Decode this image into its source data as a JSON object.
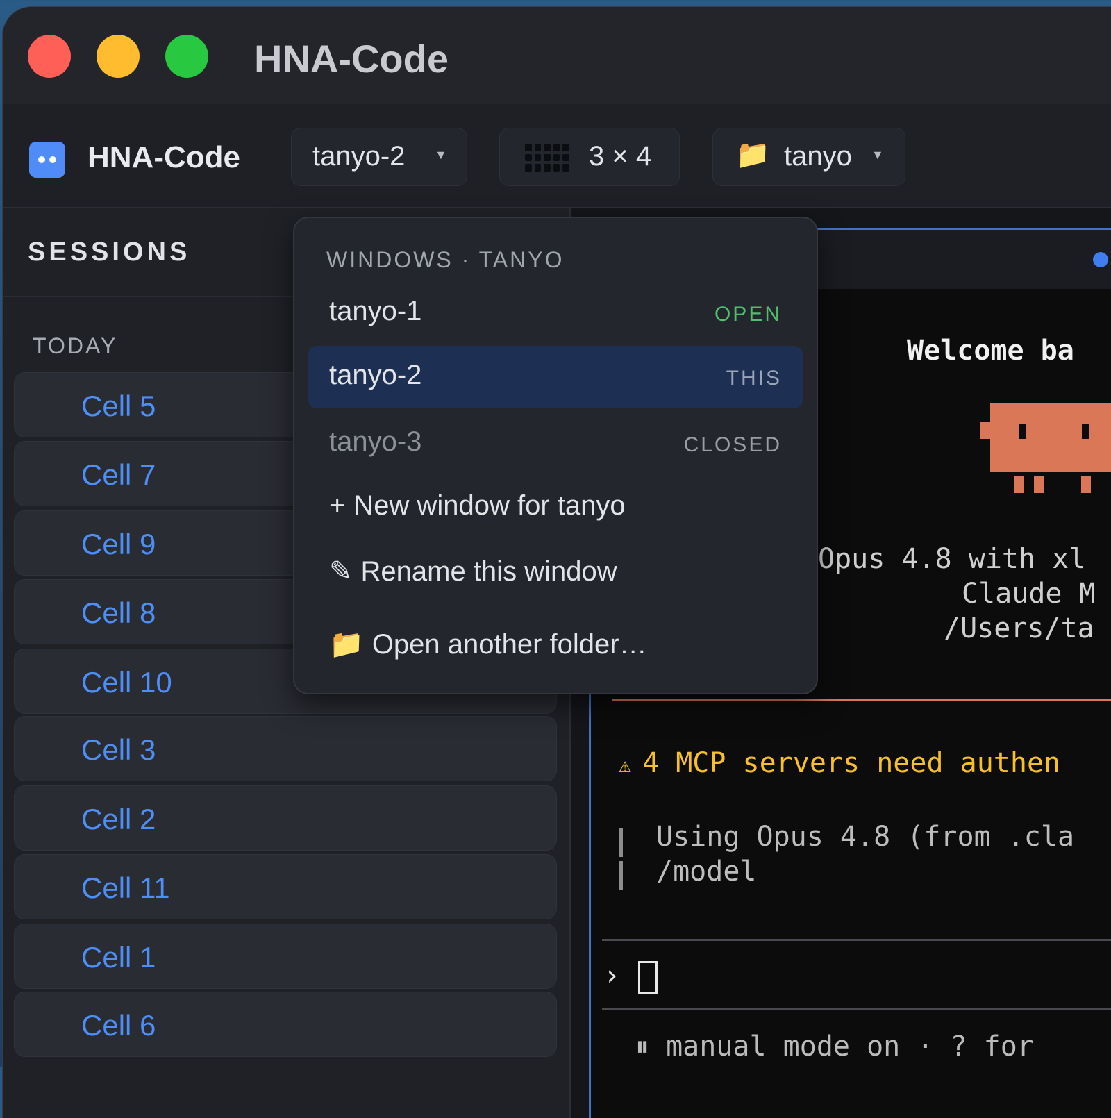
{
  "window": {
    "title": "HNA-Code"
  },
  "toolbar": {
    "app_name": "HNA-Code",
    "session_selector": {
      "value": "tanyo-2"
    },
    "grid_layout": {
      "value": "3 × 4"
    },
    "folder_selector": {
      "value": "tanyo"
    }
  },
  "sidebar": {
    "heading": "SESSIONS",
    "group_label": "TODAY",
    "cells": [
      "Cell 5",
      "Cell 7",
      "Cell 9",
      "Cell 8",
      "Cell 10",
      "Cell 3",
      "Cell 2",
      "Cell 11",
      "Cell 1",
      "Cell 6"
    ]
  },
  "dropdown": {
    "header": "WINDOWS · TANYO",
    "windows": [
      {
        "name": "tanyo-1",
        "status": "OPEN",
        "status_color": "#4fbf6b"
      },
      {
        "name": "tanyo-2",
        "status": "THIS",
        "status_color": "#9aa4b8"
      },
      {
        "name": "tanyo-3",
        "status": "CLOSED",
        "status_color": "#9a9da5"
      }
    ],
    "actions": {
      "new_window": "New window for tanyo",
      "rename": "Rename this window",
      "open_folder": "Open another folder…"
    }
  },
  "terminal": {
    "welcome": "Welcome ba",
    "model_info": "Opus 4.8 with xl",
    "org_line": "Claude M",
    "path_line": "/Users/ta",
    "warning": "4 MCP servers need authen",
    "using_model": "Using Opus 4.8 (from .cla",
    "model_cmd": "/model",
    "prompt_symbol": "›",
    "footer": "⏸ manual mode on · ? for"
  },
  "colors": {
    "accent": "#4d8ef7",
    "warning": "#f7c02a",
    "mascot": "#d97757"
  }
}
